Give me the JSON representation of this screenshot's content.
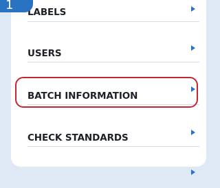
{
  "step": {
    "number": "1"
  },
  "menu": {
    "items": [
      {
        "label": "LABELS"
      },
      {
        "label": "USERS"
      },
      {
        "label": "BATCH INFORMATION",
        "highlighted": true
      },
      {
        "label": "CHECK STANDARDS"
      }
    ]
  },
  "colors": {
    "accent": "#2a72c2",
    "highlight": "#c6262b",
    "background": "#dfe9f6",
    "text": "#1d2127"
  },
  "icons": {
    "item_arrow": "caret-right-icon"
  }
}
